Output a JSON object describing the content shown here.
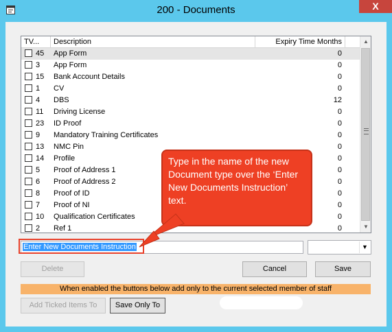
{
  "window": {
    "title": "200 - Documents",
    "close_glyph": "X",
    "title_icon": "window-icon"
  },
  "grid": {
    "columns": [
      "TV...",
      "Description",
      "Expiry Time Months"
    ],
    "rows": [
      {
        "num": "45",
        "desc": "App Form",
        "exp": "0",
        "checked": false,
        "selected": true
      },
      {
        "num": "3",
        "desc": "App Form",
        "exp": "0",
        "checked": false
      },
      {
        "num": "15",
        "desc": "Bank Account Details",
        "exp": "0",
        "checked": false
      },
      {
        "num": "1",
        "desc": "CV",
        "exp": "0",
        "checked": false
      },
      {
        "num": "4",
        "desc": "DBS",
        "exp": "12",
        "checked": false
      },
      {
        "num": "11",
        "desc": "Driving License",
        "exp": "0",
        "checked": false
      },
      {
        "num": "23",
        "desc": "ID Proof",
        "exp": "0",
        "checked": false
      },
      {
        "num": "9",
        "desc": "Mandatory Training Certificates",
        "exp": "0",
        "checked": false
      },
      {
        "num": "13",
        "desc": "NMC Pin",
        "exp": "0",
        "checked": false
      },
      {
        "num": "14",
        "desc": "Profile",
        "exp": "0",
        "checked": false
      },
      {
        "num": "5",
        "desc": "Proof of Address 1",
        "exp": "0",
        "checked": false
      },
      {
        "num": "6",
        "desc": "Proof of Address 2",
        "exp": "0",
        "checked": false
      },
      {
        "num": "8",
        "desc": "Proof of ID",
        "exp": "0",
        "checked": false
      },
      {
        "num": "7",
        "desc": "Proof of NI",
        "exp": "0",
        "checked": false
      },
      {
        "num": "10",
        "desc": "Qualification Certificates",
        "exp": "0",
        "checked": false
      },
      {
        "num": "2",
        "desc": "Ref 1",
        "exp": "0",
        "checked": false
      }
    ]
  },
  "new_doc": {
    "value": "Enter New Documents Instruction",
    "select_value": ""
  },
  "buttons": {
    "delete": "Delete",
    "cancel": "Cancel",
    "save": "Save",
    "add_ticked": "Add Ticked Items To",
    "save_only": "Save Only To"
  },
  "notice": "When enabled the buttons below add only to the current selected member of staff",
  "callout": "Type in the name of the new Document type over the ‘Enter New Documents Instruction’ text.",
  "colors": {
    "titlebar": "#5bc8ec",
    "close": "#c7453d",
    "notice": "#f8b36a",
    "callout": "#ee4024",
    "selection": "#3399ff"
  }
}
